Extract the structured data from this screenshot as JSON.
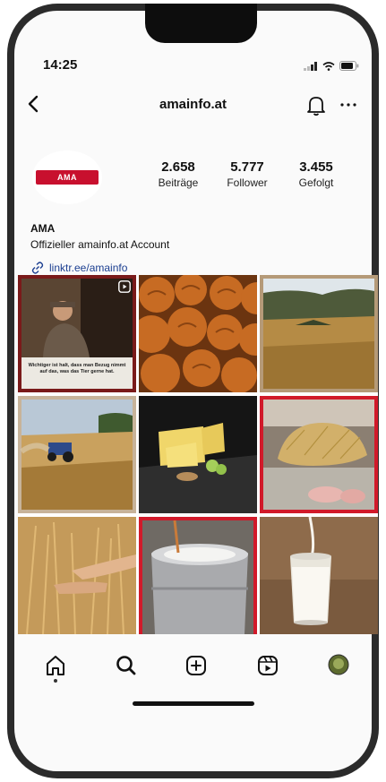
{
  "status_bar": {
    "time": "14:25"
  },
  "header": {
    "username": "amainfo.at"
  },
  "profile": {
    "logo_text": "AMA",
    "name": "AMA",
    "bio": "Offizieller amainfo.at Account",
    "link": "linktr.ee/amainfo",
    "stats": [
      {
        "value": "2.658",
        "label": "Beiträge"
      },
      {
        "value": "5.777",
        "label": "Follower"
      },
      {
        "value": "3.455",
        "label": "Gefolgt"
      }
    ]
  },
  "posts": [
    {
      "subject": "farmer-in-barn-reel",
      "caption": "Wichtiger ist halt, dass man Bezug nimmt auf das, was das Tier gerne hat."
    },
    {
      "subject": "bread-rolls"
    },
    {
      "subject": "grain-field-landscape"
    },
    {
      "subject": "tractor-in-field"
    },
    {
      "subject": "cheese-board"
    },
    {
      "subject": "pigs-with-straw"
    },
    {
      "subject": "hands-in-wheat"
    },
    {
      "subject": "milk-vat"
    },
    {
      "subject": "glass-of-milk"
    }
  ],
  "nav": [
    "home-icon",
    "search-icon",
    "create-icon",
    "reels-icon",
    "profile-icon"
  ],
  "colors": {
    "brand_red": "#c8102e",
    "link": "#1c3f91"
  }
}
